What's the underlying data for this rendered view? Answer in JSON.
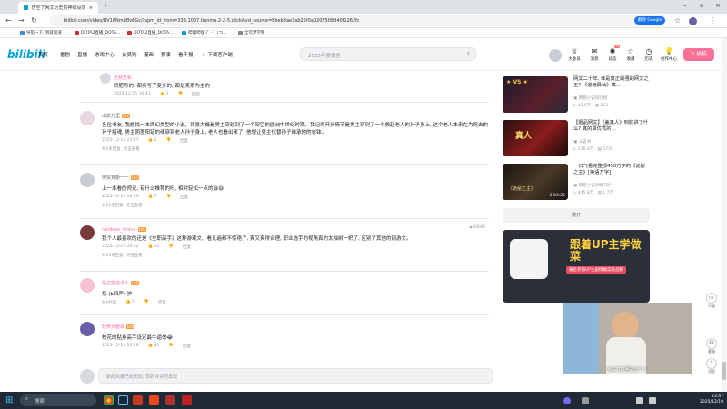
{
  "browser": {
    "tab_title": "悟空了网文历史的神级设定...",
    "url": "bilibili.com/video/BV16Nm9BvEGc/?spm_id_from=333.1007.tianma.2-2-5.click&vd_source=8beb8ae3ab25f0a0205508d40f1262fc",
    "translate_label": "翻译 Google",
    "bookmarks": [
      "导航一下, 到就知道",
      "DOTA2直播_DOTA...",
      "DOTA2直播_DOTA...",
      "哔哩哔哩 (゜-゜)つ...",
      "全可梦学和"
    ]
  },
  "header": {
    "logo": "bilibili",
    "nav": [
      "首页",
      "番剧",
      "直播",
      "游戏中心",
      "会员购",
      "漫画",
      "赛事",
      "看年报",
      "下载客户端"
    ],
    "search_placeholder": "2025年度报告",
    "icons": [
      {
        "icon": "crown-icon",
        "label": "大会员"
      },
      {
        "icon": "message-icon",
        "label": "消息"
      },
      {
        "icon": "dynamic-icon",
        "label": "动态",
        "badge": "44"
      },
      {
        "icon": "star-icon",
        "label": "收藏"
      },
      {
        "icon": "history-icon",
        "label": "历史"
      },
      {
        "icon": "create-icon",
        "label": "创作中心"
      }
    ],
    "upload": "投稿"
  },
  "comments": [
    {
      "user": "无我无私",
      "text": "同肥写的, 都卖写了变多的, 都是克系为主的",
      "time": "2025-12-15 16:41",
      "likes": "1",
      "reply": "回复"
    },
    {
      "user": "山影万里",
      "text": "各位书友, 我想找一本西幻类型的小说。背景大概是男主穿越到了一个架空的欧洲中世纪时期。我记得开头情节是男主穿到了一个救赶老人的孙子身上, 这个老人本来在为死去的孙子招魂, 男主阴差阳错的魂穿到老人孙子身上, 老人也看出来了, 他想让男主代替孙子继承他的衣钵。",
      "time": "2025-12-13 22:47",
      "likes": "2",
      "reply": "回复",
      "more": "共2条回复, 点击查看"
    },
    {
      "user": "阿贾克斯一一",
      "text": "上一本看的师兄, 有什么推荐的吗, 相对轻松一点的😄😄",
      "time": "2025-12-13 18:29",
      "likes": "7",
      "reply": "回复",
      "more": "共11条回复, 点击查看"
    },
    {
      "user": "rainbow_cheny",
      "text": "我个人最喜欢的还是《全职高手》这种游戏文、看几遍都不惊艳了, 爽又爽得合理, 职业选手的视角真的太独树一帜了, 区别了其他的网游文。",
      "time": "2025-12-13 20:52",
      "likes": "51",
      "reply": "回复",
      "more": "共23条回复, 点击查看"
    },
    {
      "user": "最正能说书人",
      "text": "瓶 (b四声) 护",
      "time": "9小时前",
      "likes": "1",
      "reply": "回复"
    },
    {
      "user": "轻微大脑袋",
      "text": "校花的贴身高手设定最牛逼😎😂",
      "time": "2025-12-13 16:28",
      "likes": "81",
      "reply": "回复"
    }
  ],
  "comment_input_placeholder": "新的风暴已经出现, 你的评评时再现",
  "sidebar": {
    "videos": [
      {
        "title": "网文二十年, 谁是真正最强的网文之王? 《道诡异仙》真...",
        "up": "网络小说排行榜",
        "views": "42.5万",
        "comments": "223"
      },
      {
        "title": "【烟品网文】《盖真人》到底讲了什么? 真的算优秀的...",
        "up": "斗说书",
        "views": "236.0万",
        "comments": "5735"
      },
      {
        "title": "一口气看完整部450万字的《诡秘之主》[英语万字]",
        "up": "网络小说讲解TOP",
        "views": "445.8万",
        "comments": "1.7万",
        "duration": "2:03:25"
      }
    ],
    "expand": "展开",
    "ad_text": "跟着UP主学做菜",
    "ad_sub": "报名参加UP主剧情做菜挑战赛",
    "side_icons": [
      "小窗",
      "客服",
      "顶部"
    ]
  },
  "pip": {
    "caption": "大关刀拉回来五个人"
  },
  "taskbar": {
    "search": "搜索",
    "time": "23:47",
    "date": "2025/12/19"
  }
}
